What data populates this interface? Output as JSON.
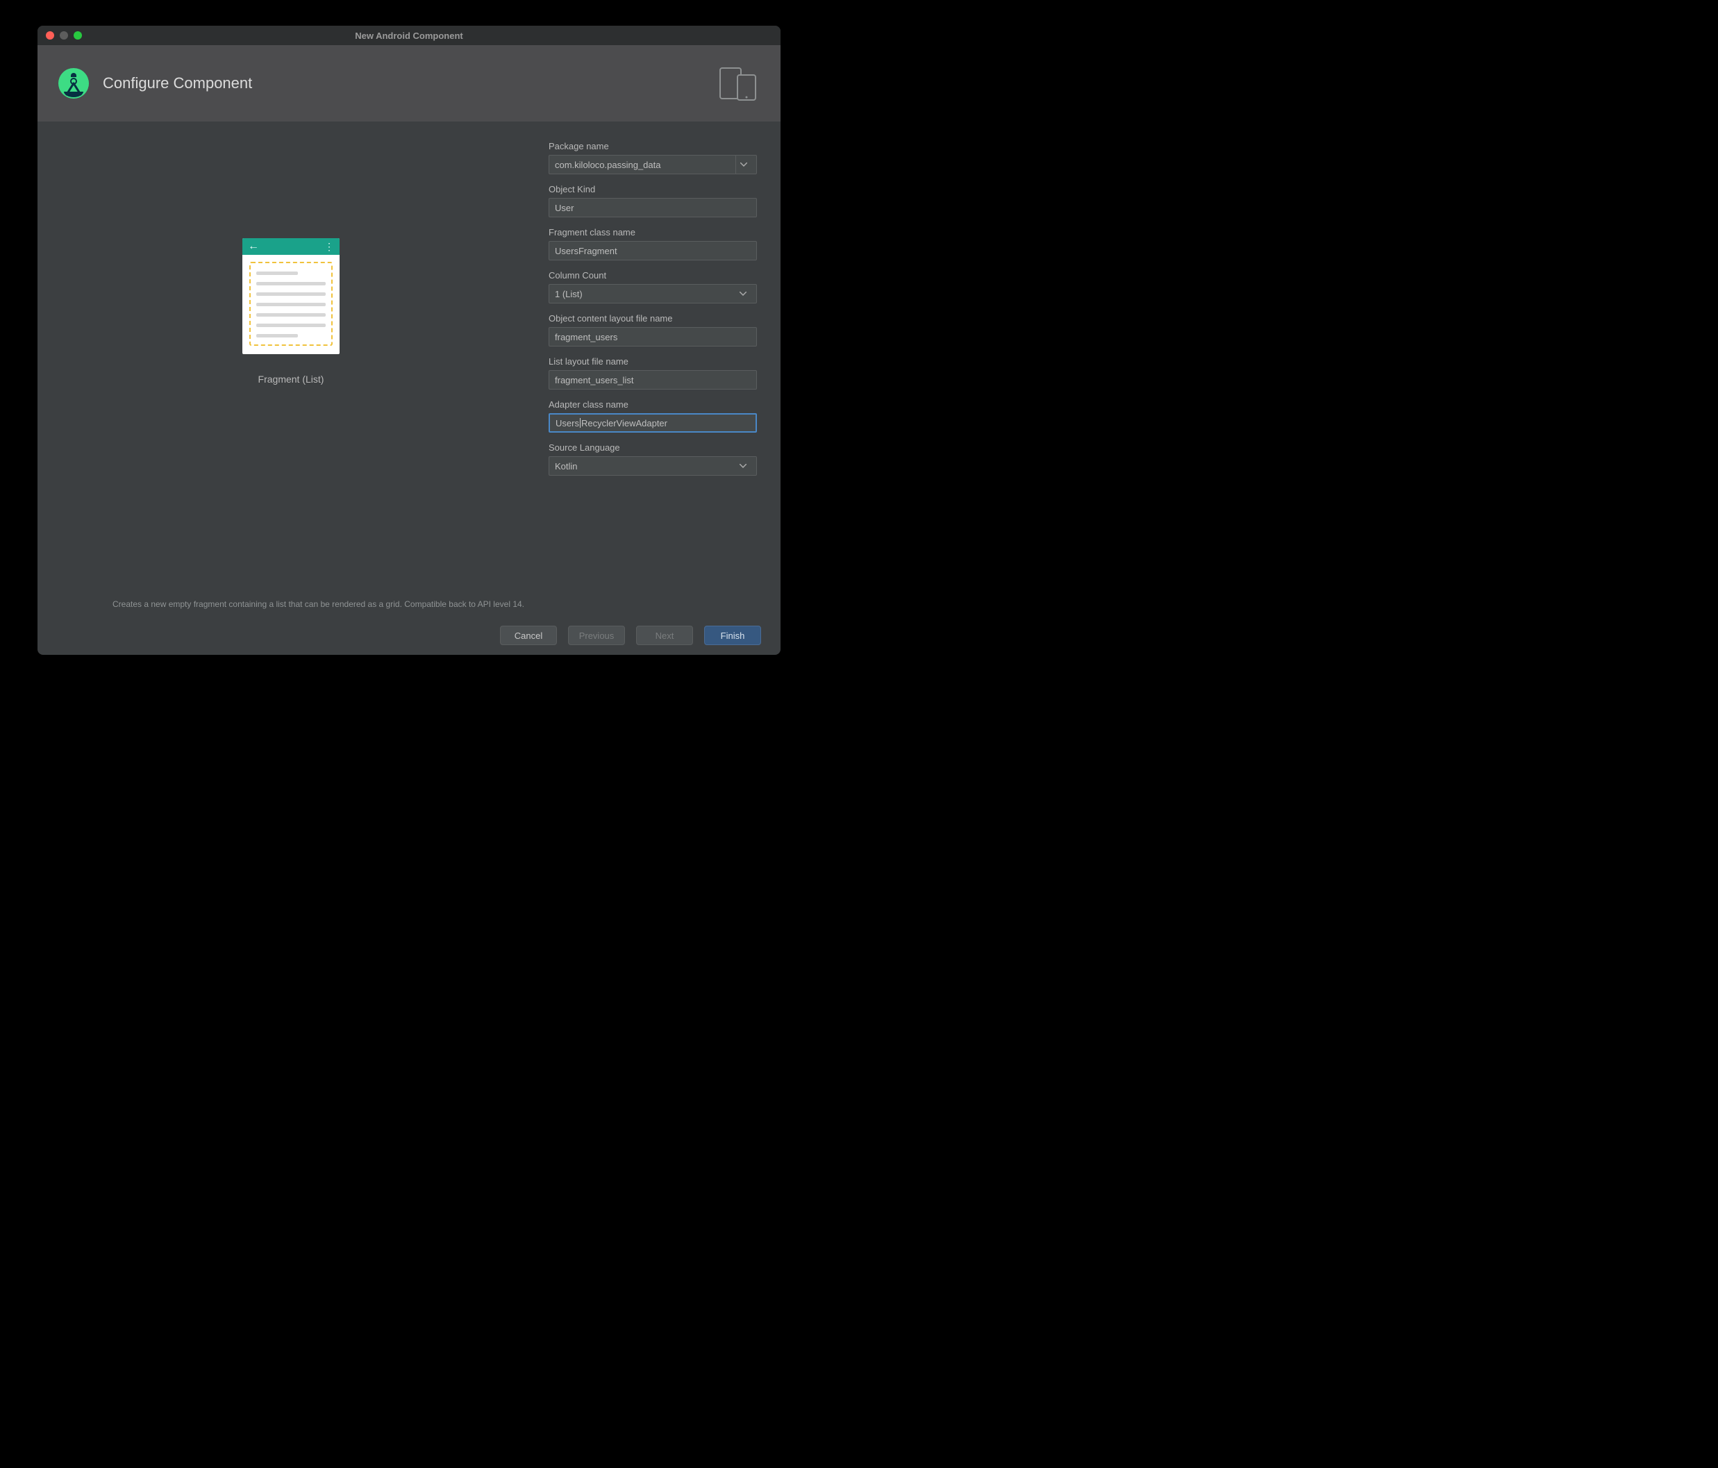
{
  "window": {
    "title": "New Android Component"
  },
  "header": {
    "title": "Configure Component"
  },
  "preview": {
    "caption": "Fragment (List)"
  },
  "form": {
    "package_name": {
      "label": "Package name",
      "value": "com.kiloloco.passing_data"
    },
    "object_kind": {
      "label": "Object Kind",
      "value": "User"
    },
    "fragment_class": {
      "label": "Fragment class name",
      "value": "UsersFragment"
    },
    "column_count": {
      "label": "Column Count",
      "value": "1 (List)"
    },
    "content_layout": {
      "label": "Object content layout file name",
      "value": "fragment_users"
    },
    "list_layout": {
      "label": "List layout file name",
      "value": "fragment_users_list"
    },
    "adapter_class": {
      "label": "Adapter class name",
      "value_pre": "Users",
      "value_post": "RecyclerViewAdapter"
    },
    "source_language": {
      "label": "Source Language",
      "value": "Kotlin"
    }
  },
  "description": "Creates a new empty fragment containing a list that can be rendered as a grid. Compatible back to API level 14.",
  "footer": {
    "cancel": "Cancel",
    "previous": "Previous",
    "next": "Next",
    "finish": "Finish"
  }
}
